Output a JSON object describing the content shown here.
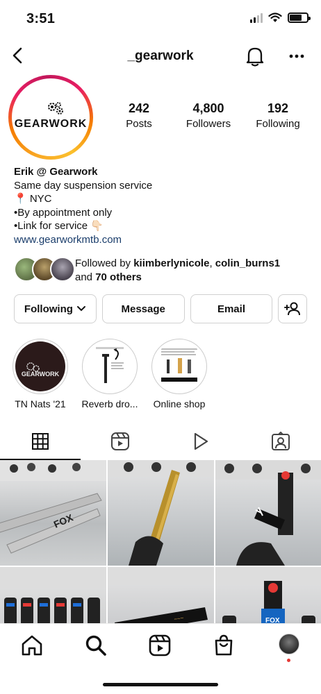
{
  "status": {
    "time": "3:51"
  },
  "header": {
    "handle": "_gearwork"
  },
  "profile": {
    "logo_text": "GEARWORK",
    "stats": [
      {
        "value": "242",
        "label": "Posts"
      },
      {
        "value": "4,800",
        "label": "Followers"
      },
      {
        "value": "192",
        "label": "Following"
      }
    ],
    "bio": {
      "name": "Erik @ Gearwork",
      "line1": "Same day suspension service",
      "line2": "📍 NYC",
      "line3": "•By appointment only",
      "line4": "•Link for service 👇🏻",
      "link": "www.gearworkmtb.com"
    },
    "followed_by": {
      "prefix": "Followed by ",
      "user1": "kiimberlynicole",
      "sep": ", ",
      "user2": "colin_burns1",
      "and": "and ",
      "others": "70 others"
    }
  },
  "actions": {
    "following": "Following",
    "message": "Message",
    "email": "Email"
  },
  "highlights": [
    {
      "label": "TN Nats '21"
    },
    {
      "label": "Reverb dro..."
    },
    {
      "label": "Online shop"
    }
  ],
  "colors": {
    "link": "#1a3d6b",
    "ring_start": "#f9a825",
    "ring_end": "#c2185b",
    "notification_dot": "#e53935"
  }
}
